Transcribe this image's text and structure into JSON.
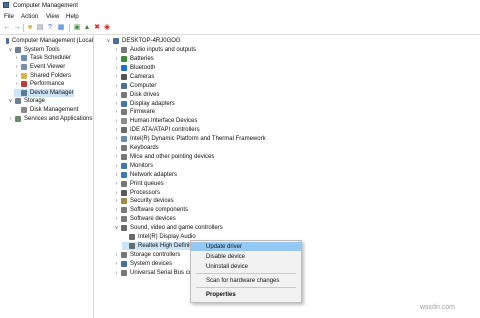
{
  "window": {
    "title": "Computer Management"
  },
  "menu": [
    "File",
    "Action",
    "View",
    "Help"
  ],
  "toolbar": [
    {
      "name": "back-arrow-icon",
      "glyph": "←",
      "color": "#2a6fc9"
    },
    {
      "name": "forward-arrow-icon",
      "glyph": "→",
      "color": "#2a6fc9"
    },
    {
      "name": "folder-icon",
      "glyph": "■",
      "color": "#d9b44a"
    },
    {
      "name": "properties-icon",
      "glyph": "▤",
      "color": "#6a7a8a"
    },
    {
      "name": "help-icon",
      "glyph": "?",
      "color": "#2a6fc9"
    },
    {
      "name": "console-view-icon",
      "glyph": "▦",
      "color": "#2a6fc9"
    },
    {
      "name": "scan-hardware-icon",
      "glyph": "▣",
      "color": "#3d8a3d"
    },
    {
      "name": "update-driver-icon",
      "glyph": "▲",
      "color": "#3d8a3d"
    },
    {
      "name": "uninstall-x-icon",
      "glyph": "✖",
      "color": "#d22"
    },
    {
      "name": "disable-device-icon",
      "glyph": "◉",
      "color": "#c22"
    }
  ],
  "left_tree": [
    {
      "label": "Computer Management (Local",
      "indent": 0,
      "chev": "",
      "icon": "#4a6e9e",
      "name": "tree-computer-management"
    },
    {
      "label": "System Tools",
      "indent": 1,
      "chev": "∨",
      "icon": "#6e7f94",
      "name": "tree-system-tools"
    },
    {
      "label": "Task Scheduler",
      "indent": 2,
      "chev": "›",
      "icon": "#6b8fb3",
      "name": "tree-task-scheduler"
    },
    {
      "label": "Event Viewer",
      "indent": 2,
      "chev": "›",
      "icon": "#7a90a8",
      "name": "tree-event-viewer"
    },
    {
      "label": "Shared Folders",
      "indent": 2,
      "chev": "›",
      "icon": "#d9b44a",
      "name": "tree-shared-folders"
    },
    {
      "label": "Performance",
      "indent": 2,
      "chev": "›",
      "icon": "#c23b3b",
      "name": "tree-performance"
    },
    {
      "label": "Device Manager",
      "indent": 2,
      "chev": "",
      "icon": "#5a7a9a",
      "name": "tree-device-manager",
      "selected": true
    },
    {
      "label": "Storage",
      "indent": 1,
      "chev": "∨",
      "icon": "#6e7f94",
      "name": "tree-storage"
    },
    {
      "label": "Disk Management",
      "indent": 2,
      "chev": "",
      "icon": "#8a8a8a",
      "name": "tree-disk-management"
    },
    {
      "label": "Services and Applications",
      "indent": 1,
      "chev": "›",
      "icon": "#6a8a6a",
      "name": "tree-services-applications"
    }
  ],
  "right_tree": [
    {
      "label": "DESKTOP-4RJ0GOG",
      "indent": 0,
      "chev": "∨",
      "icon": "#4a6e9e"
    },
    {
      "label": "Audio inputs and outputs",
      "indent": 1,
      "chev": "›",
      "icon": "#7a7a7a"
    },
    {
      "label": "Batteries",
      "indent": 1,
      "chev": "›",
      "icon": "#3c8c3c"
    },
    {
      "label": "Bluetooth",
      "indent": 1,
      "chev": "›",
      "icon": "#1f6fd1"
    },
    {
      "label": "Cameras",
      "indent": 1,
      "chev": "›",
      "icon": "#555555"
    },
    {
      "label": "Computer",
      "indent": 1,
      "chev": "›",
      "icon": "#4a6e9e"
    },
    {
      "label": "Disk drives",
      "indent": 1,
      "chev": "›",
      "icon": "#777777"
    },
    {
      "label": "Display adapters",
      "indent": 1,
      "chev": "›",
      "icon": "#3b78b5"
    },
    {
      "label": "Firmware",
      "indent": 1,
      "chev": "›",
      "icon": "#7a7a7a"
    },
    {
      "label": "Human Interface Devices",
      "indent": 1,
      "chev": "›",
      "icon": "#8a8a8a"
    },
    {
      "label": "IDE ATA/ATAPI controllers",
      "indent": 1,
      "chev": "›",
      "icon": "#6a6a6a"
    },
    {
      "label": "Intel(R) Dynamic Platform and Thermal Framework",
      "indent": 1,
      "chev": "›",
      "icon": "#6a8ab0"
    },
    {
      "label": "Keyboards",
      "indent": 1,
      "chev": "›",
      "icon": "#777777"
    },
    {
      "label": "Mice and other pointing devices",
      "indent": 1,
      "chev": "›",
      "icon": "#777777"
    },
    {
      "label": "Monitors",
      "indent": 1,
      "chev": "›",
      "icon": "#3b78b5"
    },
    {
      "label": "Network adapters",
      "indent": 1,
      "chev": "›",
      "icon": "#3b78b5"
    },
    {
      "label": "Print queues",
      "indent": 1,
      "chev": "›",
      "icon": "#777777"
    },
    {
      "label": "Processors",
      "indent": 1,
      "chev": "›",
      "icon": "#5a5a5a"
    },
    {
      "label": "Security devices",
      "indent": 1,
      "chev": "›",
      "icon": "#a08a3c"
    },
    {
      "label": "Software components",
      "indent": 1,
      "chev": "›",
      "icon": "#7a7a7a"
    },
    {
      "label": "Software devices",
      "indent": 1,
      "chev": "›",
      "icon": "#7a7a7a"
    },
    {
      "label": "Sound, video and game controllers",
      "indent": 1,
      "chev": "∨",
      "icon": "#6a6a6a"
    },
    {
      "label": "Intel(R) Display Audio",
      "indent": 2,
      "chev": "",
      "icon": "#6a6a6a"
    },
    {
      "label": "Realtek High Definitio",
      "indent": 2,
      "chev": "",
      "icon": "#6a6a6a",
      "selected": true
    },
    {
      "label": "Storage controllers",
      "indent": 1,
      "chev": "›",
      "icon": "#777777"
    },
    {
      "label": "System devices",
      "indent": 1,
      "chev": "›",
      "icon": "#4a6e9e"
    },
    {
      "label": "Universal Serial Bus contro",
      "indent": 1,
      "chev": "›",
      "icon": "#777777"
    }
  ],
  "context_menu": {
    "update": "Update driver",
    "disable": "Disable device",
    "uninstall": "Uninstall device",
    "scan": "Scan for hardware changes",
    "properties": "Properties"
  },
  "watermark": "wsxdn.com"
}
